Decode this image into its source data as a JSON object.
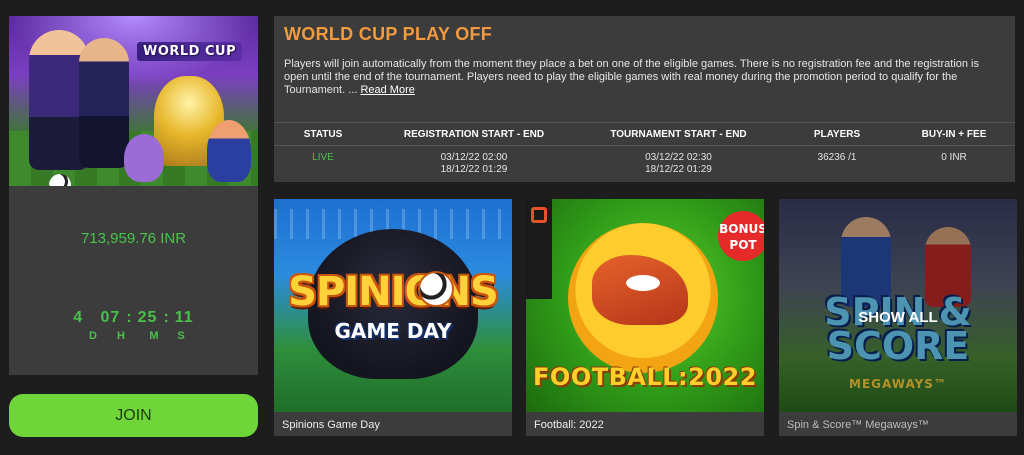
{
  "banner": {
    "label": "WORLD CUP"
  },
  "prize": {
    "amount": "713,959.76 INR"
  },
  "countdown": {
    "days": "4",
    "hours": "07",
    "minutes": "25",
    "seconds": "11",
    "separator": ":",
    "labels": {
      "days": "D",
      "hours": "H",
      "minutes": "M",
      "seconds": "S"
    }
  },
  "join_button": {
    "label": "JOIN"
  },
  "colors": {
    "accent_orange": "#f19a3e",
    "green": "#4cc34c",
    "join_bg": "#6fd63a",
    "panel_bg": "#3c3c3c",
    "page_bg": "#1d1d1d"
  },
  "tournament": {
    "title": "WORLD CUP PLAY OFF",
    "description": "Players will join automatically from the moment they place a bet on one of the eligible games. There is no registration fee and the registration is open until the end of the tournament. Players need to play the eligible games with real money during the promotion period to qualify for the Tournament. ...",
    "read_more": "Read More",
    "table": {
      "headers": [
        "STATUS",
        "REGISTRATION START - END",
        "TOURNAMENT START - END",
        "PLAYERS",
        "BUY-IN + FEE"
      ],
      "row": {
        "status": "LIVE",
        "registration_start": "03/12/22 02:00",
        "registration_end": "18/12/22 01:29",
        "tournament_start": "03/12/22 02:30",
        "tournament_end": "18/12/22 01:29",
        "players": "36236 /1",
        "buyin": "0 INR"
      }
    }
  },
  "games": [
    {
      "name": "Spinions Game Day",
      "art_title": "SPINIONS",
      "art_subtitle": "GAME DAY"
    },
    {
      "name": "Football: 2022",
      "art_title": "FOOTBALL:2022",
      "badge": "BONUS POT"
    },
    {
      "name": "Spin & Score™ Megaways™",
      "art_title": "SPIN & SCORE",
      "art_subtitle": "MEGAWAYS™",
      "overlay_label": "SHOW ALL"
    }
  ],
  "icons": [
    "soccer-ball-icon",
    "star-icon",
    "provider-logo-icon"
  ]
}
